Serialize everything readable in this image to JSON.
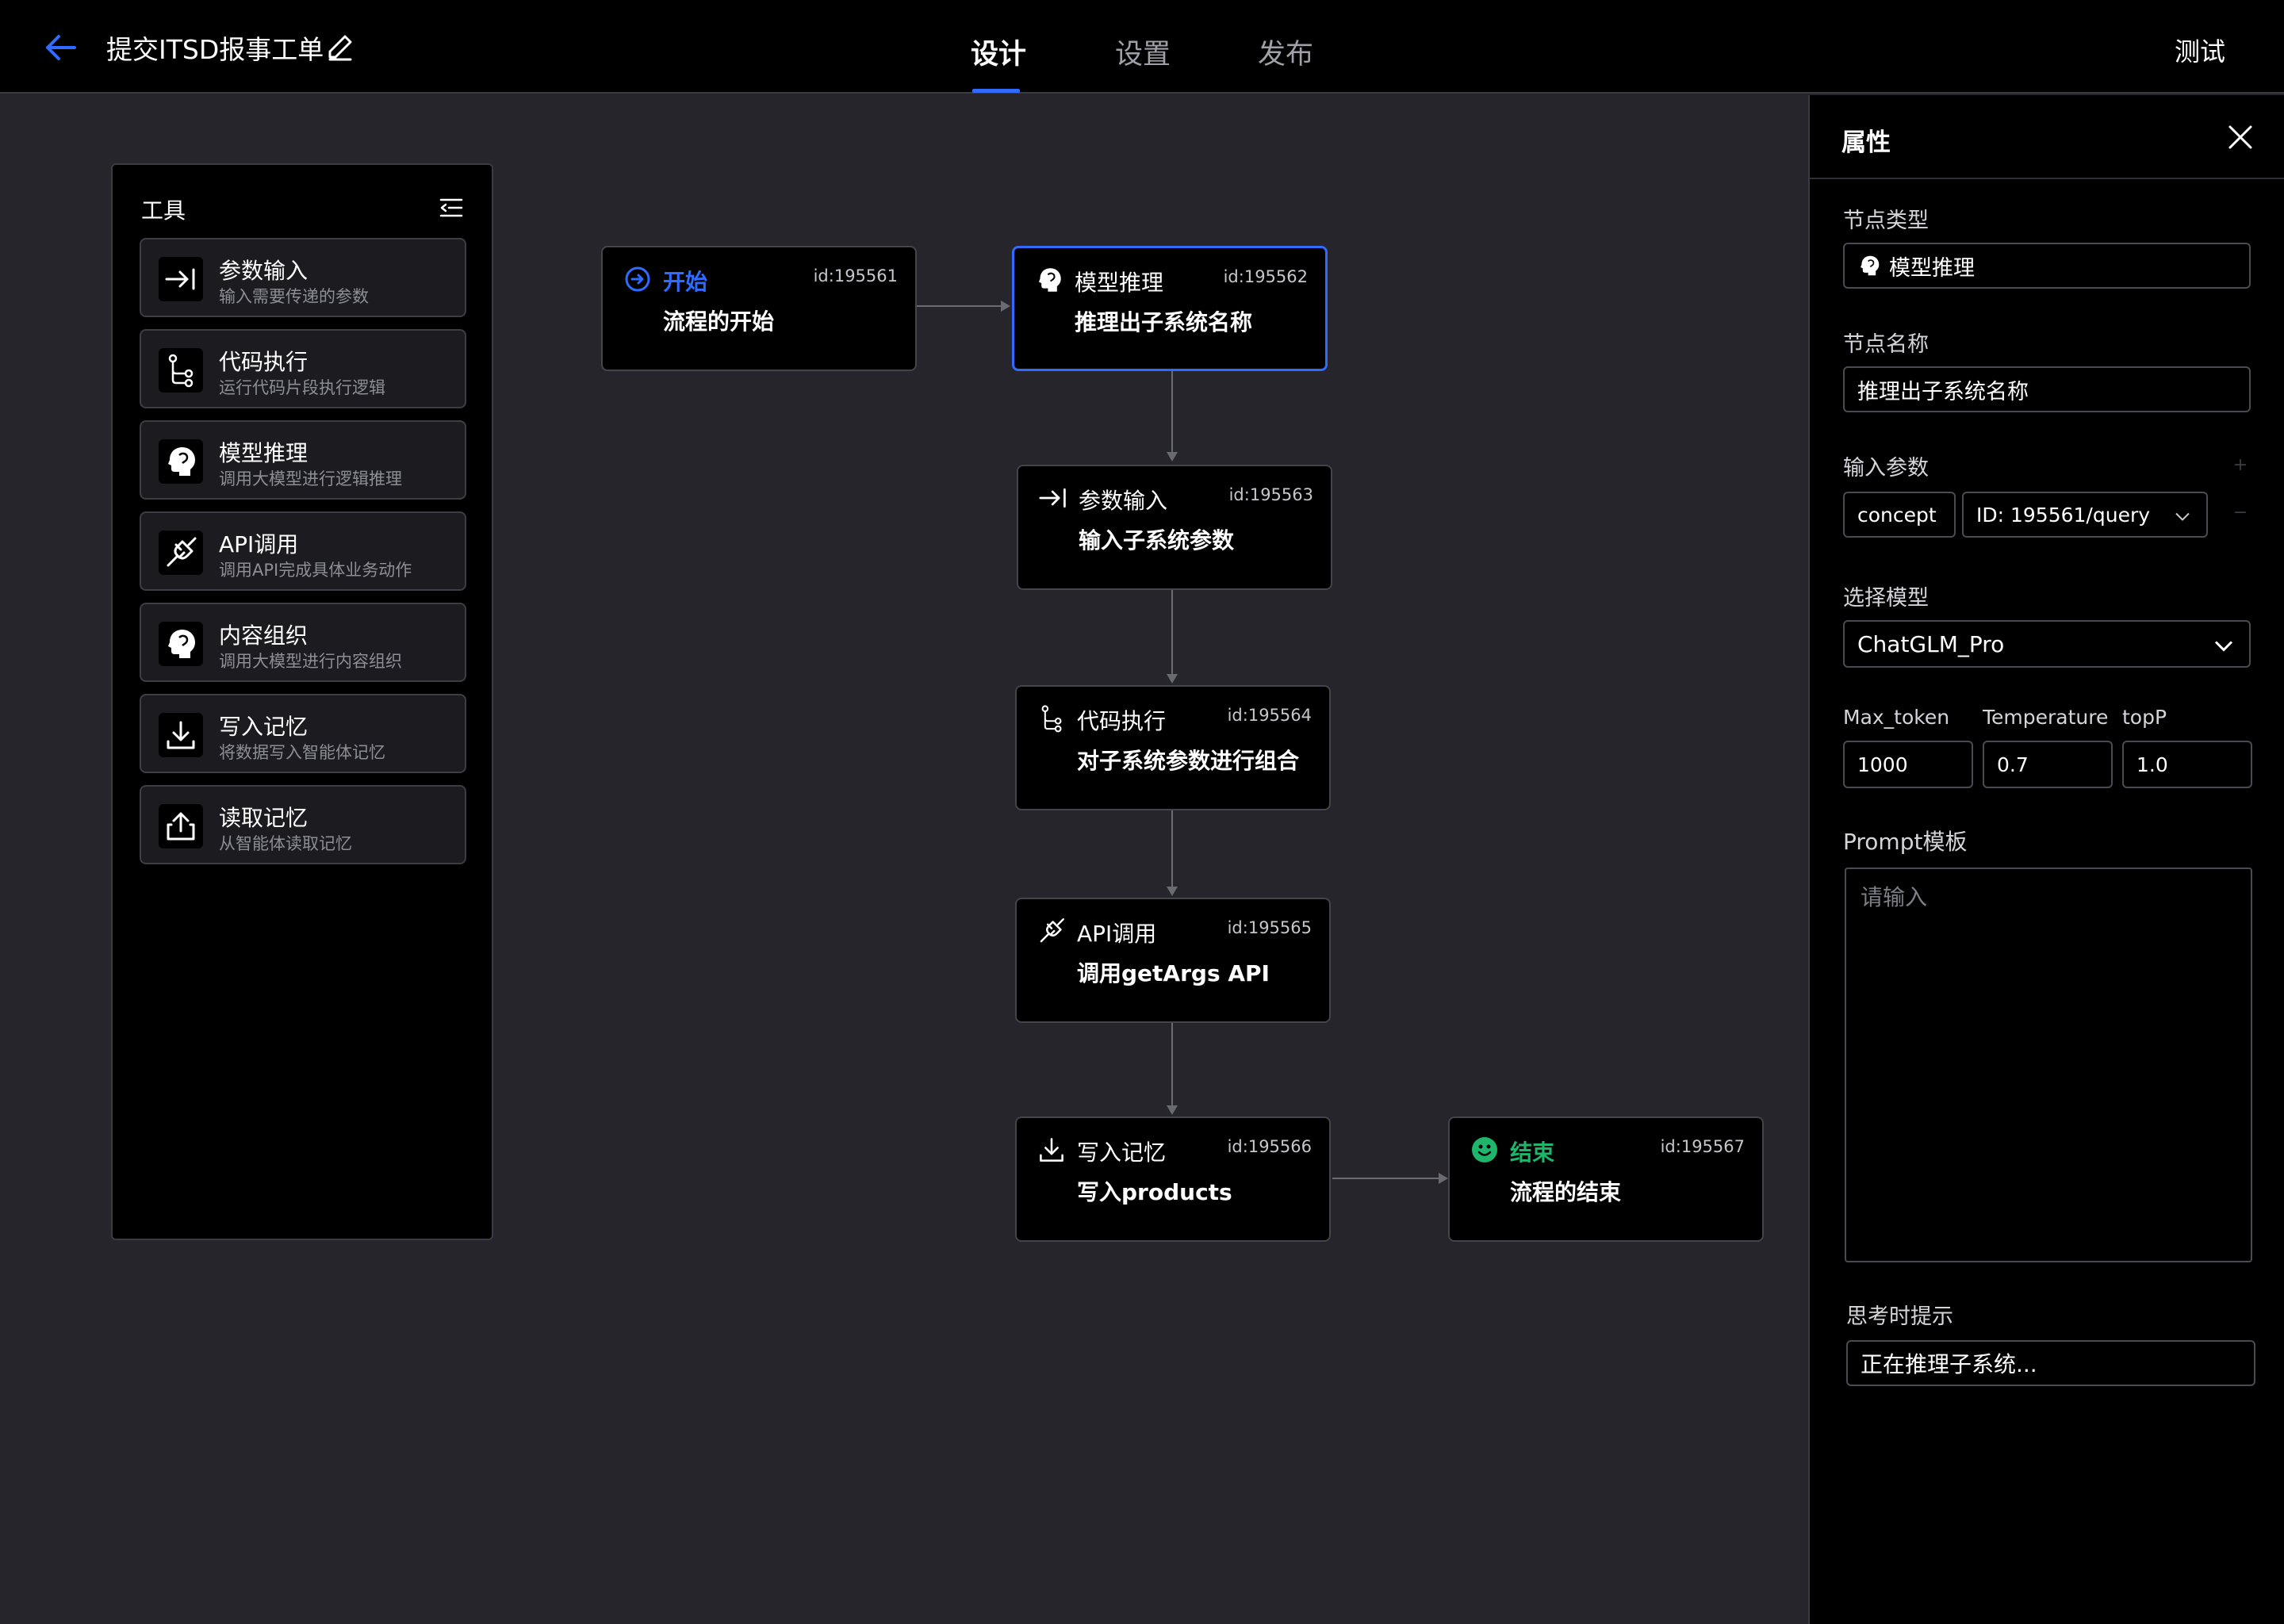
{
  "header": {
    "title": "提交ITSD报事工单",
    "tabs": [
      {
        "label": "设计",
        "active": true
      },
      {
        "label": "设置",
        "active": false
      },
      {
        "label": "发布",
        "active": false
      }
    ],
    "test_label": "测试"
  },
  "tools": {
    "title": "工具",
    "items": [
      {
        "name": "参数输入",
        "desc": "输入需要传递的参数",
        "icon": "arrow-to-bar-icon"
      },
      {
        "name": "代码执行",
        "desc": "运行代码片段执行逻辑",
        "icon": "branch-icon"
      },
      {
        "name": "模型推理",
        "desc": "调用大模型进行逻辑推理",
        "icon": "head-icon"
      },
      {
        "name": "API调用",
        "desc": "调用API完成具体业务动作",
        "icon": "plug-icon"
      },
      {
        "name": "内容组织",
        "desc": "调用大模型进行内容组织",
        "icon": "head-icon"
      },
      {
        "name": "写入记忆",
        "desc": "将数据写入智能体记忆",
        "icon": "download-icon"
      },
      {
        "name": "读取记忆",
        "desc": "从智能体读取记忆",
        "icon": "upload-icon"
      }
    ]
  },
  "nodes": [
    {
      "type": "开始",
      "id": "id:195561",
      "name": "流程的开始",
      "icon": "start-circle-icon",
      "color": "#2f6bff"
    },
    {
      "type": "模型推理",
      "id": "id:195562",
      "name": "推理出子系统名称",
      "icon": "head-icon",
      "selected": true
    },
    {
      "type": "参数输入",
      "id": "id:195563",
      "name": "输入子系统参数",
      "icon": "arrow-to-bar-icon"
    },
    {
      "type": "代码执行",
      "id": "id:195564",
      "name": "对子系统参数进行组合",
      "icon": "branch-icon"
    },
    {
      "type": "API调用",
      "id": "id:195565",
      "name": "调用getArgs API",
      "icon": "plug-icon"
    },
    {
      "type": "写入记忆",
      "id": "id:195566",
      "name": "写入products",
      "icon": "download-icon"
    },
    {
      "type": "结束",
      "id": "id:195567",
      "name": "流程的结束",
      "icon": "smile-icon",
      "color": "#1fb56a"
    }
  ],
  "properties": {
    "title": "属性",
    "node_type_label": "节点类型",
    "node_type_value": "模型推理",
    "node_name_label": "节点名称",
    "node_name_value": "推理出子系统名称",
    "input_params_label": "输入参数",
    "param_name": "concept",
    "param_source": "ID: 195561/query",
    "model_label": "选择模型",
    "model_value": "ChatGLM_Pro",
    "max_token_label": "Max_token",
    "max_token_value": "1000",
    "temperature_label": "Temperature",
    "temperature_value": "0.7",
    "topp_label": "topP",
    "topp_value": "1.0",
    "prompt_label": "Prompt模板",
    "prompt_placeholder": "请输入",
    "thinking_label": "思考时提示",
    "thinking_value": "正在推理子系统..."
  },
  "colors": {
    "accent": "#2f6bff",
    "end_green": "#1fb56a",
    "background": "#25252b",
    "panel": "#000000"
  }
}
